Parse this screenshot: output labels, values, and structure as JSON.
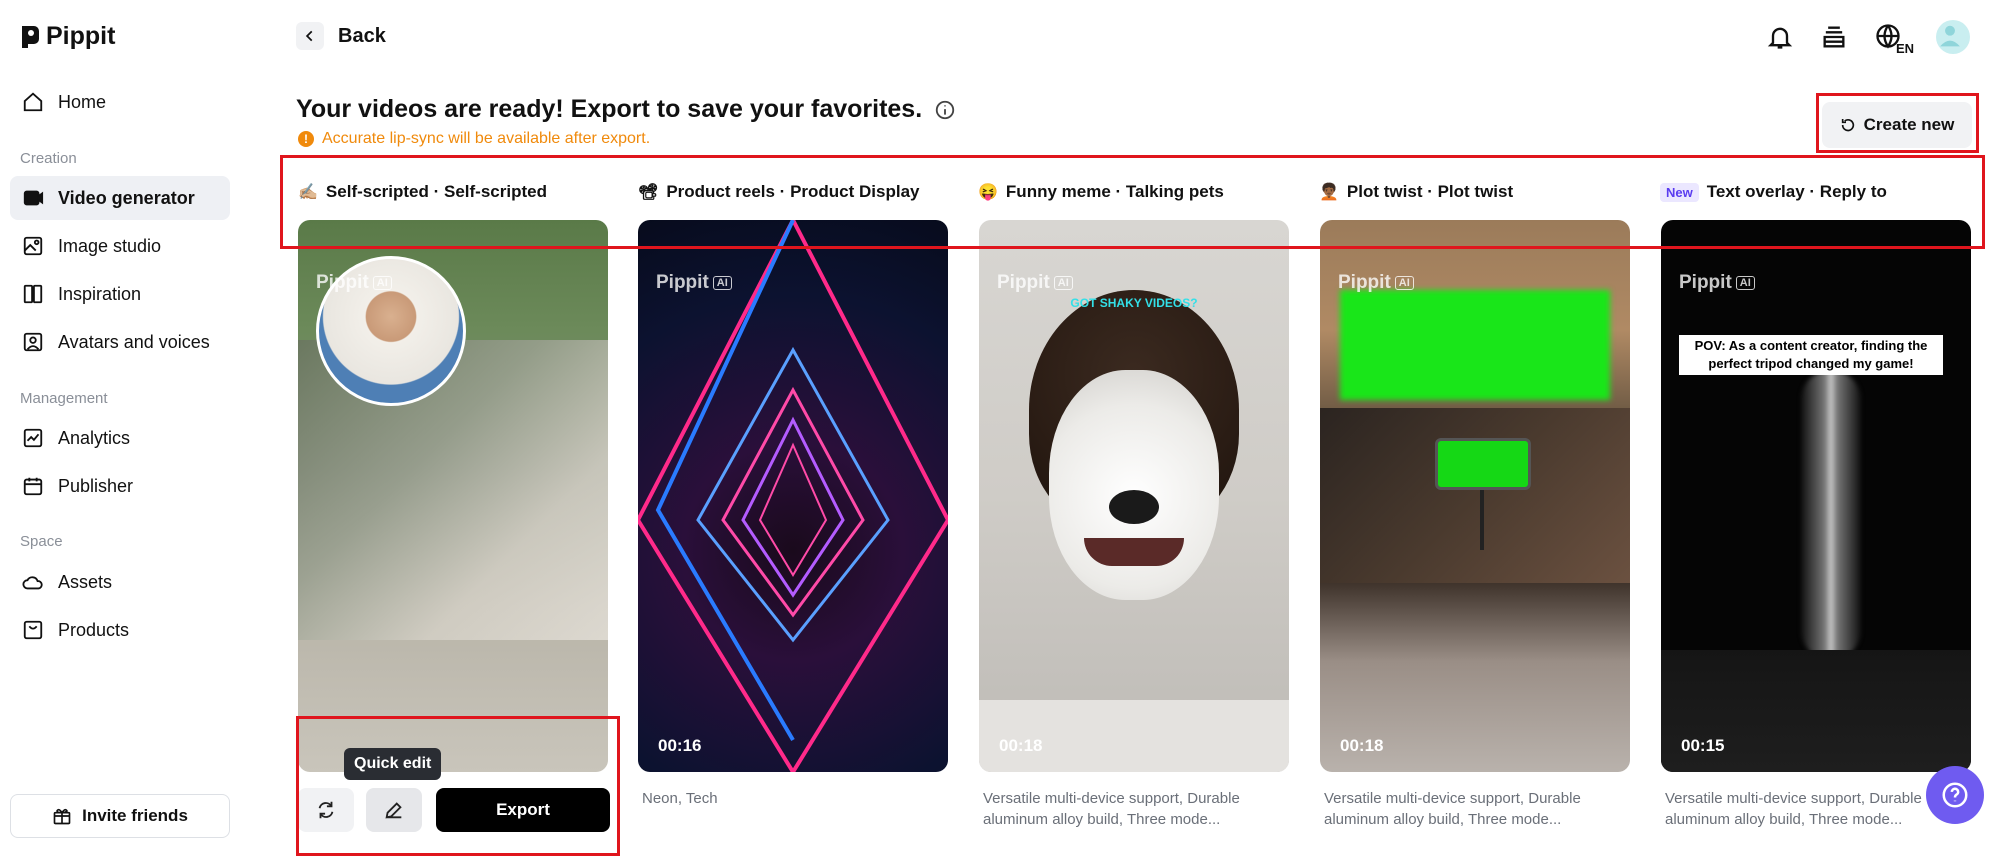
{
  "app": {
    "name": "Pippit"
  },
  "sidebar": {
    "home": "Home",
    "creation_label": "Creation",
    "items_creation": [
      "Video generator",
      "Image studio",
      "Inspiration",
      "Avatars and voices"
    ],
    "management_label": "Management",
    "items_management": [
      "Analytics",
      "Publisher"
    ],
    "space_label": "Space",
    "items_space": [
      "Assets",
      "Products"
    ],
    "invite": "Invite friends"
  },
  "header": {
    "back": "Back",
    "language": "EN",
    "title": "Your videos are ready! Export to save your favorites.",
    "warning": "Accurate lip-sync will be available after export.",
    "create_new": "Create new"
  },
  "columns": [
    {
      "emoji": "✍🏼",
      "title": "Self-scripted · Self-scripted",
      "watermark": "Pippit",
      "duration": "",
      "description": ""
    },
    {
      "emoji": "📽",
      "title": "Product reels · Product Display",
      "watermark": "Pippit",
      "duration": "00:16",
      "description": "Neon, Tech"
    },
    {
      "emoji": "😝",
      "title": "Funny meme · Talking pets",
      "watermark": "Pippit",
      "duration": "00:18",
      "description": "Versatile multi-device support, Durable aluminum alloy build, Three mode...",
      "overlay": "GOT SHAKY VIDEOS?"
    },
    {
      "emoji": "🧑🏾‍🦱",
      "title": "Plot twist · Plot twist",
      "watermark": "Pippit",
      "duration": "00:18",
      "description": "Versatile multi-device support, Durable aluminum alloy build, Three mode..."
    },
    {
      "badge": "New",
      "title": "Text overlay · Reply to",
      "watermark": "Pippit",
      "duration": "00:15",
      "description": "Versatile multi-device support, Durable aluminum alloy build, Three mode...",
      "caption": "POV: As a content creator, finding the perfect tripod changed my game!"
    }
  ],
  "watermark_ai": "AI",
  "actions": {
    "tooltip": "Quick edit",
    "export": "Export"
  },
  "colors": {
    "accent_red": "#e0151d",
    "warning": "#f08a0c",
    "help": "#6f5bf0"
  }
}
